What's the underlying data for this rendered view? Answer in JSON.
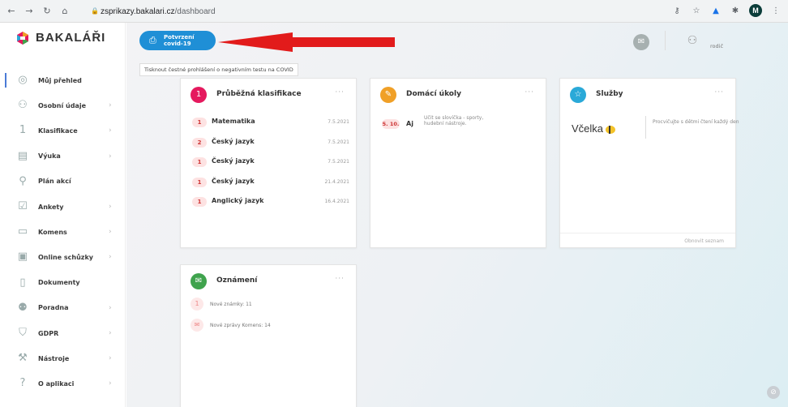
{
  "browser": {
    "url_host": "zsprikazy.bakalari.cz",
    "url_path": "/dashboard",
    "profile_initial": "M"
  },
  "sidebar": {
    "logo": "BAKALÁŘI",
    "items": [
      {
        "label": "Můj přehled",
        "icon": "gauge-icon",
        "chevron": false,
        "active": true
      },
      {
        "label": "Osobní údaje",
        "icon": "person-card-icon",
        "chevron": true
      },
      {
        "label": "Klasifikace",
        "icon": "grade-icon",
        "chevron": true
      },
      {
        "label": "Výuka",
        "icon": "book-icon",
        "chevron": true
      },
      {
        "label": "Plán akcí",
        "icon": "calendar-people-icon",
        "chevron": false
      },
      {
        "label": "Ankety",
        "icon": "checkbox-icon",
        "chevron": true
      },
      {
        "label": "Komens",
        "icon": "chat-icon",
        "chevron": true
      },
      {
        "label": "Online schůzky",
        "icon": "video-meeting-icon",
        "chevron": true
      },
      {
        "label": "Dokumenty",
        "icon": "document-icon",
        "chevron": false
      },
      {
        "label": "Poradna",
        "icon": "counseling-icon",
        "chevron": true
      },
      {
        "label": "GDPR",
        "icon": "shield-icon",
        "chevron": true
      },
      {
        "label": "Nástroje",
        "icon": "wrench-icon",
        "chevron": true
      },
      {
        "label": "O aplikaci",
        "icon": "question-icon",
        "chevron": true
      }
    ]
  },
  "topbar": {
    "covid_line1": "Potvrzení",
    "covid_line2": "covid-19",
    "tooltip": "Tisknout čestné prohlášení o negativním testu na COVID",
    "user_role": "rodič"
  },
  "cards": {
    "grades": {
      "title": "Průběžná klasifikace",
      "icon_glyph": "1",
      "rows": [
        {
          "grade": "1",
          "subject": "Matematika",
          "date": "7.5.2021"
        },
        {
          "grade": "2",
          "subject": "Český jazyk",
          "date": "7.5.2021"
        },
        {
          "grade": "1",
          "subject": "Český jazyk",
          "date": "7.5.2021"
        },
        {
          "grade": "1",
          "subject": "Český jazyk",
          "date": "21.4.2021"
        },
        {
          "grade": "1",
          "subject": "Anglický jazyk",
          "date": "16.4.2021"
        }
      ]
    },
    "homework": {
      "title": "Domácí úkoly",
      "date": "5. 10.",
      "subject": "Aj",
      "text": "Učit se slovíčka - sporty, hudební nástroje."
    },
    "services": {
      "title": "Služby",
      "brand": "Včelka",
      "text": "Procvičujte s dětmi čtení každý den",
      "refresh": "Obnovit seznam"
    },
    "announcements": {
      "title": "Oznámení",
      "rows": [
        {
          "text": "Nové známky: 11",
          "glyph": "1"
        },
        {
          "text": "Nové zprávy Komens: 14",
          "glyph": "✉"
        }
      ]
    }
  },
  "colors": {
    "covid_button": "#1f8fd6",
    "grades_icon": "#e5195e",
    "homework_icon": "#f0a027",
    "services_icon": "#2aa9d8",
    "announcements_icon": "#3fa34d",
    "arrow": "#e21b1b"
  }
}
